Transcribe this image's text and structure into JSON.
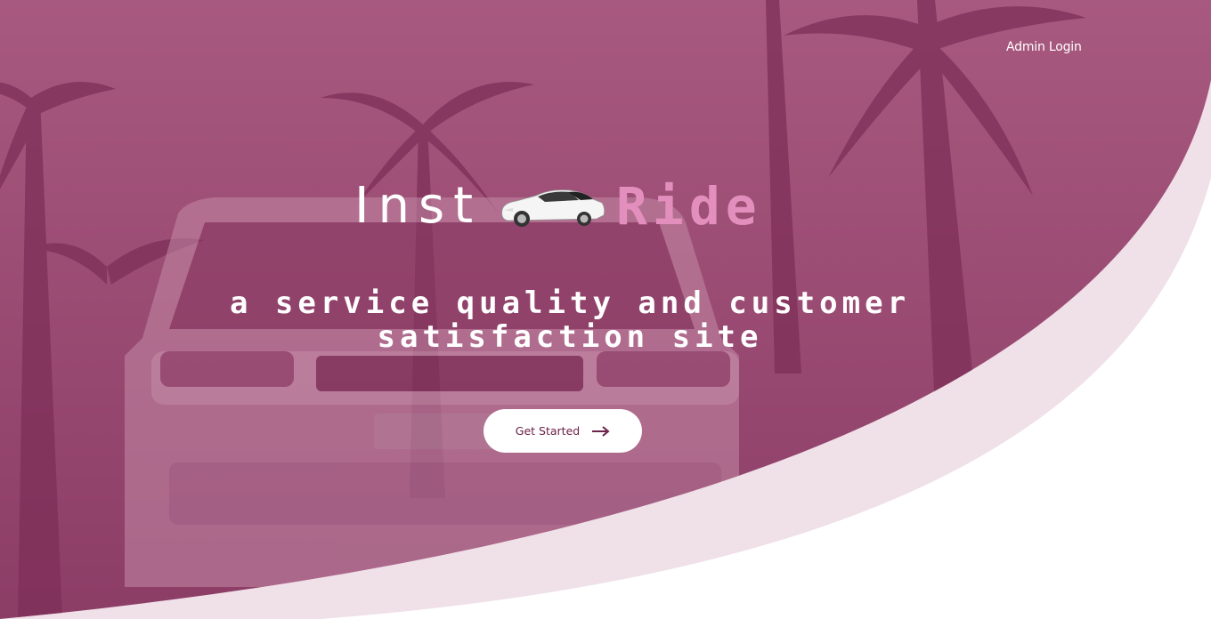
{
  "nav": {
    "admin_login": "Admin Login"
  },
  "hero": {
    "brand_prefix": "Inst",
    "brand_suffix": "Ride",
    "brand_icon": "car-icon",
    "tagline": "a service quality and customer satisfaction site",
    "cta_label": "Get Started",
    "cta_icon": "arrow-right-icon"
  },
  "colors": {
    "overlay": "#a3587e",
    "accent": "#e38fbe",
    "cta_text": "#6b2148",
    "background": "#ffffff"
  }
}
